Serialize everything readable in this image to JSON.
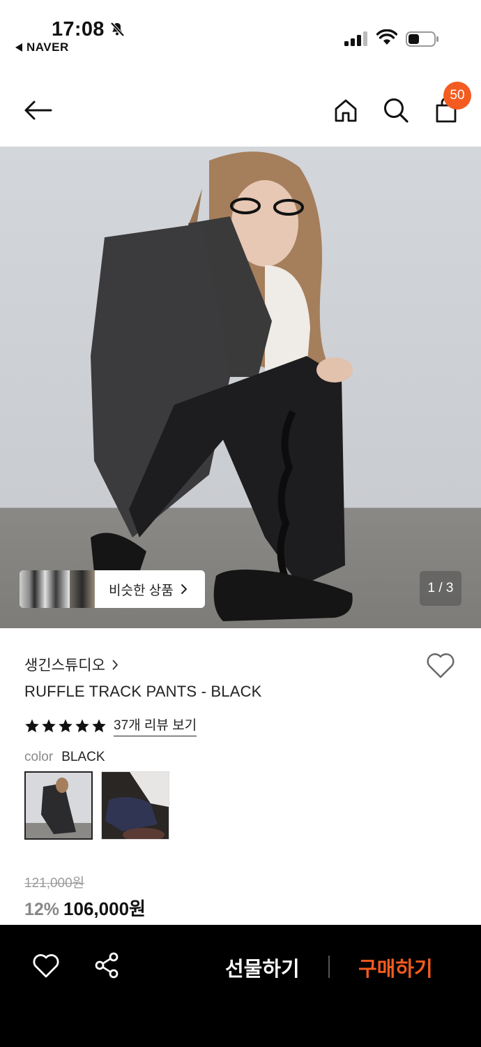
{
  "status": {
    "time": "17:08",
    "back_app": "NAVER"
  },
  "header": {
    "cart_count": "50",
    "badge_color": "#f35b20"
  },
  "gallery": {
    "similar_label": "비슷한 상품",
    "counter": "1 / 3"
  },
  "product": {
    "brand": "생긴스튜디오",
    "name": "RUFFLE TRACK PANTS - BLACK",
    "rating_stars": 5,
    "review_link": "37개 리뷰 보기",
    "color_label": "color",
    "color_value": "BLACK",
    "original_price": "121,000원",
    "discount": "12%",
    "price": "106,000원"
  },
  "bottom_bar": {
    "gift_label": "선물하기",
    "buy_label": "구매하기",
    "accent": "#f35b20"
  }
}
